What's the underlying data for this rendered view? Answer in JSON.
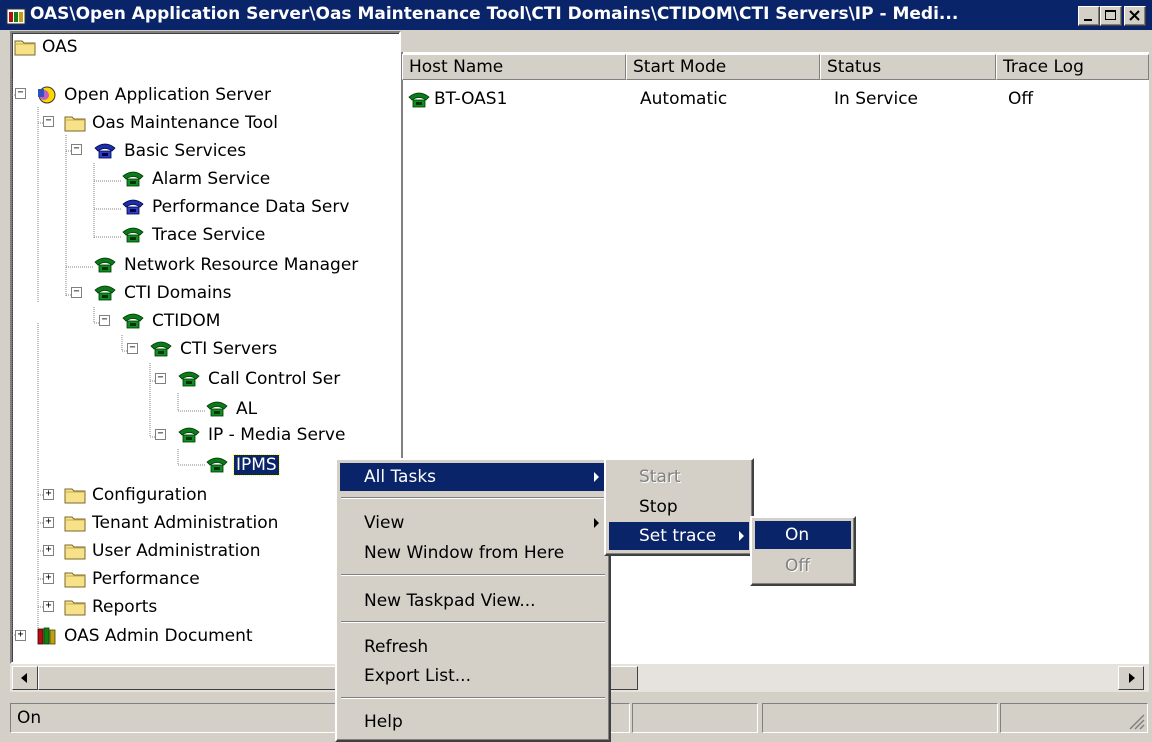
{
  "window": {
    "title": "OAS\\Open Application Server\\Oas Maintenance Tool\\CTI Domains\\CTIDOM\\CTI Servers\\IP - Medi..."
  },
  "tree": {
    "items": [
      {
        "label": "OAS"
      },
      {
        "label": "Open Application Server"
      },
      {
        "label": "Oas Maintenance Tool"
      },
      {
        "label": "Basic Services"
      },
      {
        "label": "Alarm Service"
      },
      {
        "label": "Performance Data Serv"
      },
      {
        "label": "Trace Service"
      },
      {
        "label": "Network Resource Manager"
      },
      {
        "label": "CTI Domains"
      },
      {
        "label": "CTIDOM"
      },
      {
        "label": "CTI Servers"
      },
      {
        "label": "Call Control Ser"
      },
      {
        "label": "AL"
      },
      {
        "label": "IP - Media Serve"
      },
      {
        "label": "IPMS"
      },
      {
        "label": "Configuration"
      },
      {
        "label": "Tenant Administration"
      },
      {
        "label": "User Administration"
      },
      {
        "label": "Performance"
      },
      {
        "label": "Reports"
      },
      {
        "label": "OAS Admin Document"
      }
    ]
  },
  "list": {
    "columns": [
      "Host Name",
      "Start Mode",
      "Status",
      "Trace Log"
    ],
    "rows": [
      {
        "host": "BT-OAS1",
        "start_mode": "Automatic",
        "status": "In Service",
        "trace_log": "Off"
      }
    ]
  },
  "context_menu": {
    "items": [
      "All Tasks",
      "View",
      "New Window from Here",
      "New Taskpad View...",
      "Refresh",
      "Export List...",
      "Help"
    ]
  },
  "tasks_submenu": {
    "items": [
      "Start",
      "Stop",
      "Set trace"
    ]
  },
  "trace_submenu": {
    "items": [
      "On",
      "Off"
    ]
  },
  "statusbar": {
    "text": "On"
  },
  "colors": {
    "titlebar": "#0a246a",
    "selection": "#0a246a",
    "face": "#d4d0c8"
  }
}
